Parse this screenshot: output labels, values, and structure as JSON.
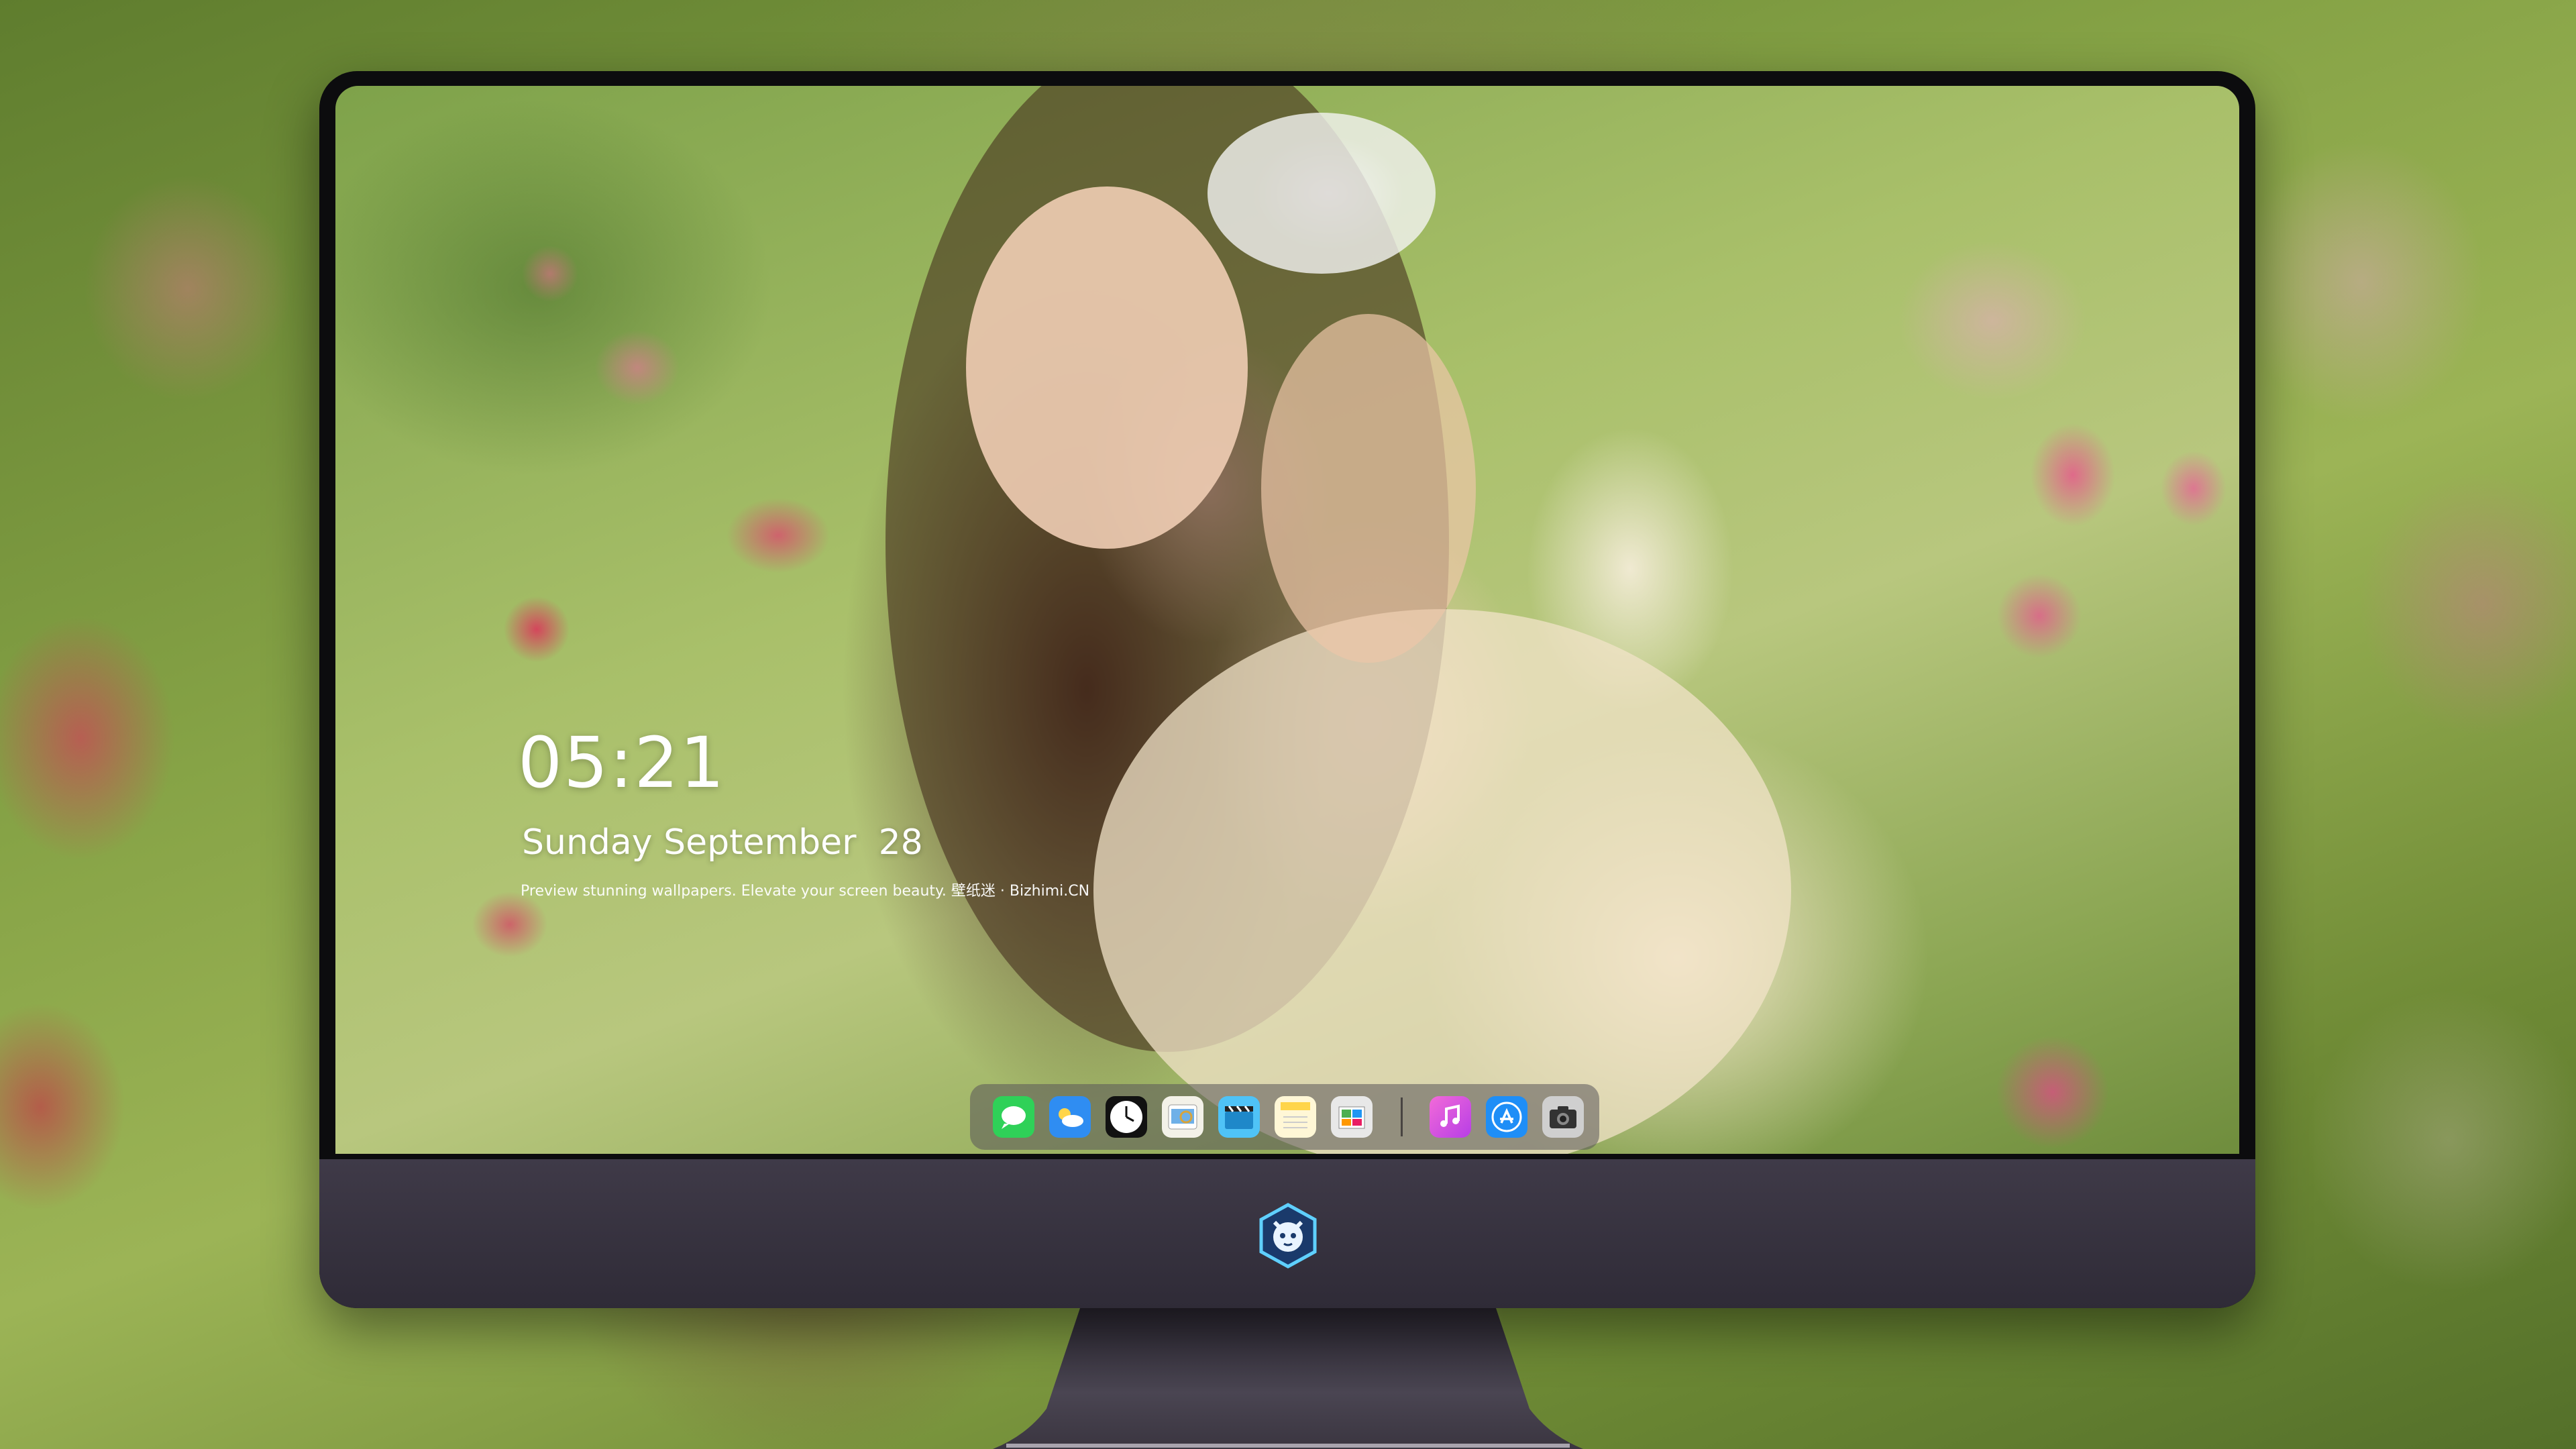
{
  "lockscreen": {
    "time": "05:21",
    "date": "Sunday September  28",
    "tagline": "Preview stunning wallpapers. Elevate your screen beauty. 壁纸迷 · Bizhimi.CN"
  },
  "dock": {
    "apps": [
      {
        "name": "messages-icon",
        "color": "#2fd158"
      },
      {
        "name": "weather-icon",
        "color": "#2f8df2"
      },
      {
        "name": "clock-icon",
        "color": "#ffffff"
      },
      {
        "name": "preview-icon",
        "color": "#f3d36b"
      },
      {
        "name": "video-icon",
        "color": "#4fc3f7"
      },
      {
        "name": "notes-icon",
        "color": "#ffd54a"
      },
      {
        "name": "photos-icon",
        "color": "#e8e8e8"
      },
      {
        "name": "music-icon",
        "color": "#e64fd9"
      },
      {
        "name": "app-store-icon",
        "color": "#1e8ef7"
      },
      {
        "name": "camera-icon",
        "color": "#d7d7d7"
      }
    ]
  },
  "colors": {
    "bezel": "#0c0c0e",
    "chin": "#3a3542",
    "dock_bg": "rgba(90,85,90,0.55)",
    "text": "#ffffff"
  }
}
